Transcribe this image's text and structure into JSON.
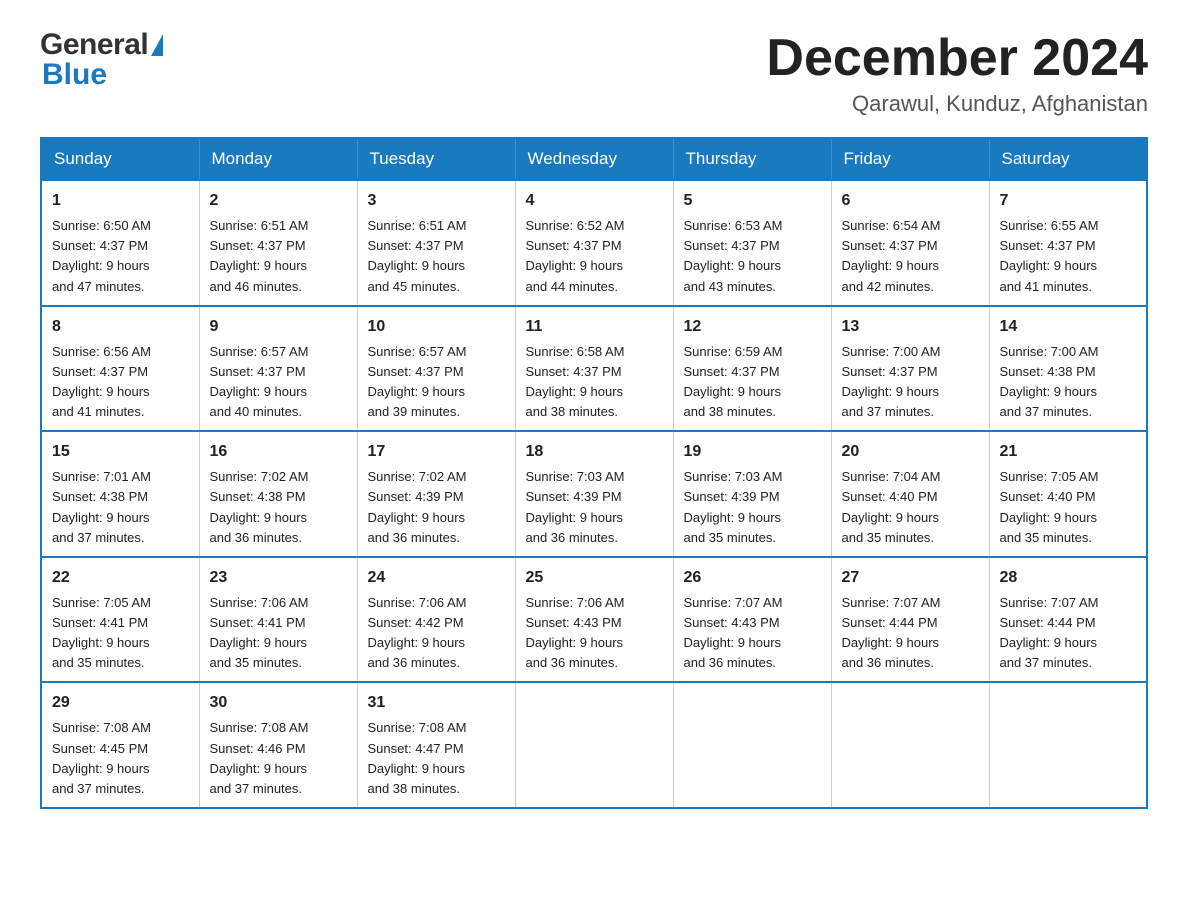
{
  "header": {
    "month_title": "December 2024",
    "location": "Qarawul, Kunduz, Afghanistan",
    "logo_general": "General",
    "logo_blue": "Blue"
  },
  "days_of_week": [
    "Sunday",
    "Monday",
    "Tuesday",
    "Wednesday",
    "Thursday",
    "Friday",
    "Saturday"
  ],
  "weeks": [
    [
      {
        "day": "1",
        "sunrise": "6:50 AM",
        "sunset": "4:37 PM",
        "daylight": "9 hours and 47 minutes."
      },
      {
        "day": "2",
        "sunrise": "6:51 AM",
        "sunset": "4:37 PM",
        "daylight": "9 hours and 46 minutes."
      },
      {
        "day": "3",
        "sunrise": "6:51 AM",
        "sunset": "4:37 PM",
        "daylight": "9 hours and 45 minutes."
      },
      {
        "day": "4",
        "sunrise": "6:52 AM",
        "sunset": "4:37 PM",
        "daylight": "9 hours and 44 minutes."
      },
      {
        "day": "5",
        "sunrise": "6:53 AM",
        "sunset": "4:37 PM",
        "daylight": "9 hours and 43 minutes."
      },
      {
        "day": "6",
        "sunrise": "6:54 AM",
        "sunset": "4:37 PM",
        "daylight": "9 hours and 42 minutes."
      },
      {
        "day": "7",
        "sunrise": "6:55 AM",
        "sunset": "4:37 PM",
        "daylight": "9 hours and 41 minutes."
      }
    ],
    [
      {
        "day": "8",
        "sunrise": "6:56 AM",
        "sunset": "4:37 PM",
        "daylight": "9 hours and 41 minutes."
      },
      {
        "day": "9",
        "sunrise": "6:57 AM",
        "sunset": "4:37 PM",
        "daylight": "9 hours and 40 minutes."
      },
      {
        "day": "10",
        "sunrise": "6:57 AM",
        "sunset": "4:37 PM",
        "daylight": "9 hours and 39 minutes."
      },
      {
        "day": "11",
        "sunrise": "6:58 AM",
        "sunset": "4:37 PM",
        "daylight": "9 hours and 38 minutes."
      },
      {
        "day": "12",
        "sunrise": "6:59 AM",
        "sunset": "4:37 PM",
        "daylight": "9 hours and 38 minutes."
      },
      {
        "day": "13",
        "sunrise": "7:00 AM",
        "sunset": "4:37 PM",
        "daylight": "9 hours and 37 minutes."
      },
      {
        "day": "14",
        "sunrise": "7:00 AM",
        "sunset": "4:38 PM",
        "daylight": "9 hours and 37 minutes."
      }
    ],
    [
      {
        "day": "15",
        "sunrise": "7:01 AM",
        "sunset": "4:38 PM",
        "daylight": "9 hours and 37 minutes."
      },
      {
        "day": "16",
        "sunrise": "7:02 AM",
        "sunset": "4:38 PM",
        "daylight": "9 hours and 36 minutes."
      },
      {
        "day": "17",
        "sunrise": "7:02 AM",
        "sunset": "4:39 PM",
        "daylight": "9 hours and 36 minutes."
      },
      {
        "day": "18",
        "sunrise": "7:03 AM",
        "sunset": "4:39 PM",
        "daylight": "9 hours and 36 minutes."
      },
      {
        "day": "19",
        "sunrise": "7:03 AM",
        "sunset": "4:39 PM",
        "daylight": "9 hours and 35 minutes."
      },
      {
        "day": "20",
        "sunrise": "7:04 AM",
        "sunset": "4:40 PM",
        "daylight": "9 hours and 35 minutes."
      },
      {
        "day": "21",
        "sunrise": "7:05 AM",
        "sunset": "4:40 PM",
        "daylight": "9 hours and 35 minutes."
      }
    ],
    [
      {
        "day": "22",
        "sunrise": "7:05 AM",
        "sunset": "4:41 PM",
        "daylight": "9 hours and 35 minutes."
      },
      {
        "day": "23",
        "sunrise": "7:06 AM",
        "sunset": "4:41 PM",
        "daylight": "9 hours and 35 minutes."
      },
      {
        "day": "24",
        "sunrise": "7:06 AM",
        "sunset": "4:42 PM",
        "daylight": "9 hours and 36 minutes."
      },
      {
        "day": "25",
        "sunrise": "7:06 AM",
        "sunset": "4:43 PM",
        "daylight": "9 hours and 36 minutes."
      },
      {
        "day": "26",
        "sunrise": "7:07 AM",
        "sunset": "4:43 PM",
        "daylight": "9 hours and 36 minutes."
      },
      {
        "day": "27",
        "sunrise": "7:07 AM",
        "sunset": "4:44 PM",
        "daylight": "9 hours and 36 minutes."
      },
      {
        "day": "28",
        "sunrise": "7:07 AM",
        "sunset": "4:44 PM",
        "daylight": "9 hours and 37 minutes."
      }
    ],
    [
      {
        "day": "29",
        "sunrise": "7:08 AM",
        "sunset": "4:45 PM",
        "daylight": "9 hours and 37 minutes."
      },
      {
        "day": "30",
        "sunrise": "7:08 AM",
        "sunset": "4:46 PM",
        "daylight": "9 hours and 37 minutes."
      },
      {
        "day": "31",
        "sunrise": "7:08 AM",
        "sunset": "4:47 PM",
        "daylight": "9 hours and 38 minutes."
      },
      null,
      null,
      null,
      null
    ]
  ],
  "labels": {
    "sunrise": "Sunrise:",
    "sunset": "Sunset:",
    "daylight": "Daylight:"
  }
}
